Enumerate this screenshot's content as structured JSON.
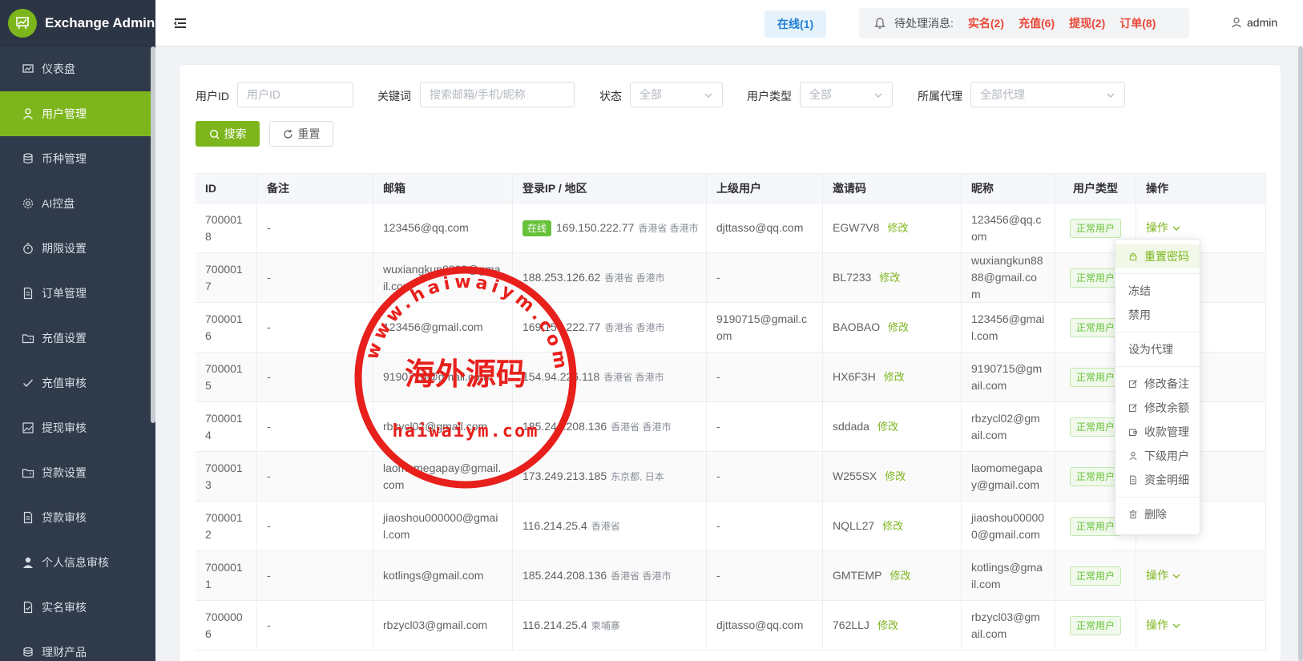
{
  "app": {
    "title": "Exchange Admin"
  },
  "sidebar": {
    "items": [
      {
        "label": "仪表盘",
        "icon": "dashboard-icon"
      },
      {
        "label": "用户管理",
        "icon": "user-icon",
        "active": true
      },
      {
        "label": "币种管理",
        "icon": "database-icon"
      },
      {
        "label": "AI控盘",
        "icon": "gear-icon"
      },
      {
        "label": "期限设置",
        "icon": "timer-icon"
      },
      {
        "label": "订单管理",
        "icon": "document-icon"
      },
      {
        "label": "充值设置",
        "icon": "folder-icon"
      },
      {
        "label": "充值审核",
        "icon": "check-icon"
      },
      {
        "label": "提现审核",
        "icon": "picture-icon"
      },
      {
        "label": "贷款设置",
        "icon": "folder-icon"
      },
      {
        "label": "贷款审核",
        "icon": "document-icon"
      },
      {
        "label": "个人信息审核",
        "icon": "person-icon"
      },
      {
        "label": "实名审核",
        "icon": "document-check-icon"
      },
      {
        "label": "理财产品",
        "icon": "coins-icon"
      }
    ]
  },
  "header": {
    "online_label": "在线(1)",
    "notice_label": "待处理消息:",
    "notice_tags": [
      "实名(2)",
      "充值(6)",
      "提现(2)",
      "订单(8)"
    ],
    "username": "admin"
  },
  "filters": {
    "user_id_label": "用户ID",
    "user_id_placeholder": "用户ID",
    "keyword_label": "关键词",
    "keyword_placeholder": "搜索邮箱/手机/昵称",
    "status_label": "状态",
    "status_value": "全部",
    "user_type_label": "用户类型",
    "user_type_value": "全部",
    "agent_label": "所属代理",
    "agent_value": "全部代理",
    "search_button": "搜索",
    "reset_button": "重置"
  },
  "table": {
    "headers": [
      "ID",
      "备注",
      "邮箱",
      "登录IP / 地区",
      "上级用户",
      "邀请码",
      "昵称",
      "用户类型",
      "操作"
    ],
    "edit_label": "修改",
    "op_label": "操作",
    "online_tag": "在线",
    "rows": [
      {
        "id": "7000018",
        "note": "-",
        "email": "123456@qq.com",
        "online": true,
        "ip": "169.150.222.77",
        "region": "香港省 香港市",
        "parent": "djttasso@qq.com",
        "invite": "EGW7V8",
        "nick": "123456@qq.com",
        "type": "正常用户"
      },
      {
        "id": "7000017",
        "note": "-",
        "email": "wuxiangkun8888@gmail.com",
        "online": false,
        "ip": "188.253.126.62",
        "region": "香港省 香港市",
        "parent": "-",
        "invite": "BL7233",
        "nick": "wuxiangkun8888@gmail.com",
        "type": "正常用户"
      },
      {
        "id": "7000016",
        "note": "-",
        "email": "123456@gmail.com",
        "online": false,
        "ip": "169.150.222.77",
        "region": "香港省 香港市",
        "parent": "9190715@gmail.com",
        "invite": "BAOBAO",
        "nick": "123456@gmail.com",
        "type": "正常用户"
      },
      {
        "id": "7000015",
        "note": "-",
        "email": "9190715@gmail.com",
        "online": false,
        "ip": "154.94.226.118",
        "region": "香港省 香港市",
        "parent": "-",
        "invite": "HX6F3H",
        "nick": "9190715@gmail.com",
        "type": "正常用户"
      },
      {
        "id": "7000014",
        "note": "-",
        "email": "rbzycl02@gmail.com",
        "online": false,
        "ip": "185.244.208.136",
        "region": "香港省 香港市",
        "parent": "-",
        "invite": "sddada",
        "nick": "rbzycl02@gmail.com",
        "type": "正常用户"
      },
      {
        "id": "7000013",
        "note": "-",
        "email": "laomomegapay@gmail.com",
        "online": false,
        "ip": "173.249.213.185",
        "region": "东京都, 日本",
        "parent": "-",
        "invite": "W255SX",
        "nick": "laomomegapay@gmail.com",
        "type": "正常用户"
      },
      {
        "id": "7000012",
        "note": "-",
        "email": "jiaoshou000000@gmail.com",
        "online": false,
        "ip": "116.214.25.4",
        "region": "香港省",
        "parent": "-",
        "invite": "NQLL27",
        "nick": "jiaoshou000000@gmail.com",
        "type": "正常用户"
      },
      {
        "id": "7000011",
        "note": "-",
        "email": "kotlings@gmail.com",
        "online": false,
        "ip": "185.244.208.136",
        "region": "香港省 香港市",
        "parent": "-",
        "invite": "GMTEMP",
        "nick": "kotlings@gmail.com",
        "type": "正常用户"
      },
      {
        "id": "7000006",
        "note": "-",
        "email": "rbzycl03@gmail.com",
        "online": false,
        "ip": "116.214.25.4",
        "region": "柬埔寨",
        "parent": "djttasso@qq.com",
        "invite": "762LLJ",
        "nick": "rbzycl03@gmail.com",
        "type": "正常用户"
      }
    ]
  },
  "dropdown": {
    "items": [
      {
        "label": "重置密码",
        "icon": "lock-icon"
      },
      {
        "label": "冻结",
        "icon": ""
      },
      {
        "label": "禁用",
        "icon": ""
      },
      {
        "label": "设为代理",
        "icon": ""
      },
      {
        "label": "修改备注",
        "icon": "edit-icon"
      },
      {
        "label": "修改余额",
        "icon": "edit-icon"
      },
      {
        "label": "收款管理",
        "icon": "wallet-icon"
      },
      {
        "label": "下级用户",
        "icon": "user-icon"
      },
      {
        "label": "资金明细",
        "icon": "document-icon"
      },
      {
        "label": "删除",
        "icon": "trash-icon"
      }
    ]
  },
  "watermark": {
    "center_text": "海外源码",
    "bottom_text": "haiwaiym.com",
    "ring_text": "www.haiwaiym.com",
    "color": "#e8201c"
  }
}
